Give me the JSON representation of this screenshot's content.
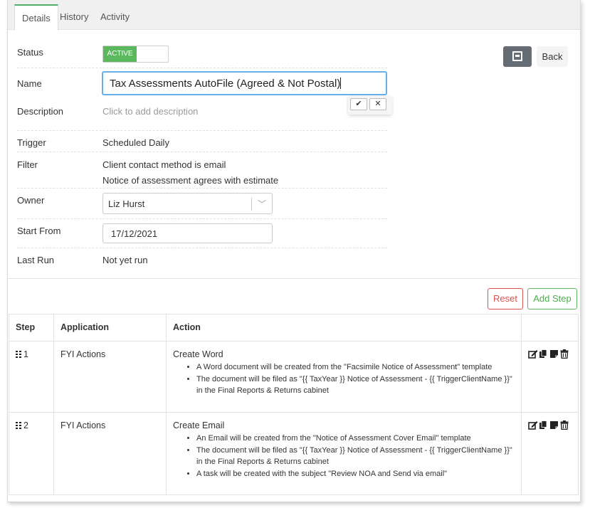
{
  "tabs": [
    {
      "label": "Details",
      "active": true
    },
    {
      "label": "History",
      "active": false
    },
    {
      "label": "Activity",
      "active": false
    }
  ],
  "details": {
    "status_label": "Status",
    "status_value": "ACTIVE",
    "name_label": "Name",
    "name_value": "Tax Assessments AutoFile (Agreed & Not Postal)",
    "description_label": "Description",
    "description_placeholder": "Click to add description",
    "trigger_label": "Trigger",
    "trigger_value": "Scheduled Daily",
    "filter_label": "Filter",
    "filter_values": [
      "Client contact method is email",
      "Notice of assessment agrees with estimate"
    ],
    "owner_label": "Owner",
    "owner_value": "Liz Hurst",
    "start_label": "Start From",
    "start_value": "17/12/2021",
    "lastrun_label": "Last Run",
    "lastrun_value": "Not yet run"
  },
  "actions": {
    "back_label": "Back",
    "reset_label": "Reset",
    "add_step_label": "Add Step"
  },
  "table": {
    "headers": [
      "Step",
      "Application",
      "Action",
      ""
    ],
    "rows": [
      {
        "step": "1",
        "application": "FYI Actions",
        "action_title": "Create Word",
        "bullets": [
          "A Word document will be created from the \"Facsimile Notice of Assessment\" template",
          "The document will be filed as \"{{ TaxYear }} Notice of Assessment - {{ TriggerClientName }}\" in the Final Reports & Returns cabinet"
        ]
      },
      {
        "step": "2",
        "application": "FYI Actions",
        "action_title": "Create Email",
        "bullets": [
          "An Email will be created from the \"Notice of Assessment Cover Email\" template",
          "The document will be filed as \"{{ TaxYear }} Notice of Assessment - {{ TriggerClientName }}\" in the Final Reports & Returns cabinet",
          "A task will be created with the subject \"Review NOA and Send via email\""
        ]
      }
    ]
  },
  "colors": {
    "accent_green": "#5cb85c",
    "danger_red": "#d9534f",
    "focus_blue": "#66afe9"
  }
}
